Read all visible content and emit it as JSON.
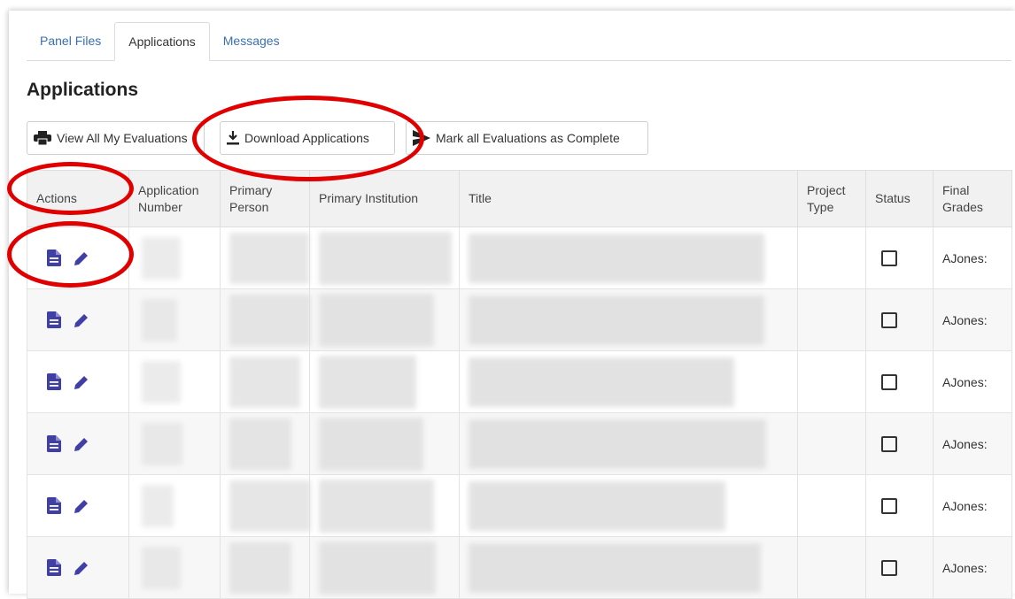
{
  "tabs": [
    {
      "label": "Panel Files"
    },
    {
      "label": "Applications"
    },
    {
      "label": "Messages"
    }
  ],
  "page": {
    "title": "Applications"
  },
  "toolbar": {
    "view_all": "View All My Evaluations",
    "download": "Download Applications",
    "mark_complete": "Mark all Evaluations as Complete"
  },
  "table": {
    "headers": {
      "actions": "Actions",
      "application_number": "Application Number",
      "primary_person": "Primary Person",
      "primary_institution": "Primary Institution",
      "title": "Title",
      "project_type": "Project Type",
      "status": "Status",
      "final_grades": "Final Grades"
    },
    "rows": [
      {
        "final_grade": "AJones:"
      },
      {
        "final_grade": "AJones:"
      },
      {
        "final_grade": "AJones:"
      },
      {
        "final_grade": "AJones:"
      },
      {
        "final_grade": "AJones:"
      },
      {
        "final_grade": "AJones:"
      }
    ]
  },
  "colors": {
    "accent_icon": "#3f3fa6",
    "annotation_ring": "#e10000",
    "link": "#3a6fb0"
  }
}
